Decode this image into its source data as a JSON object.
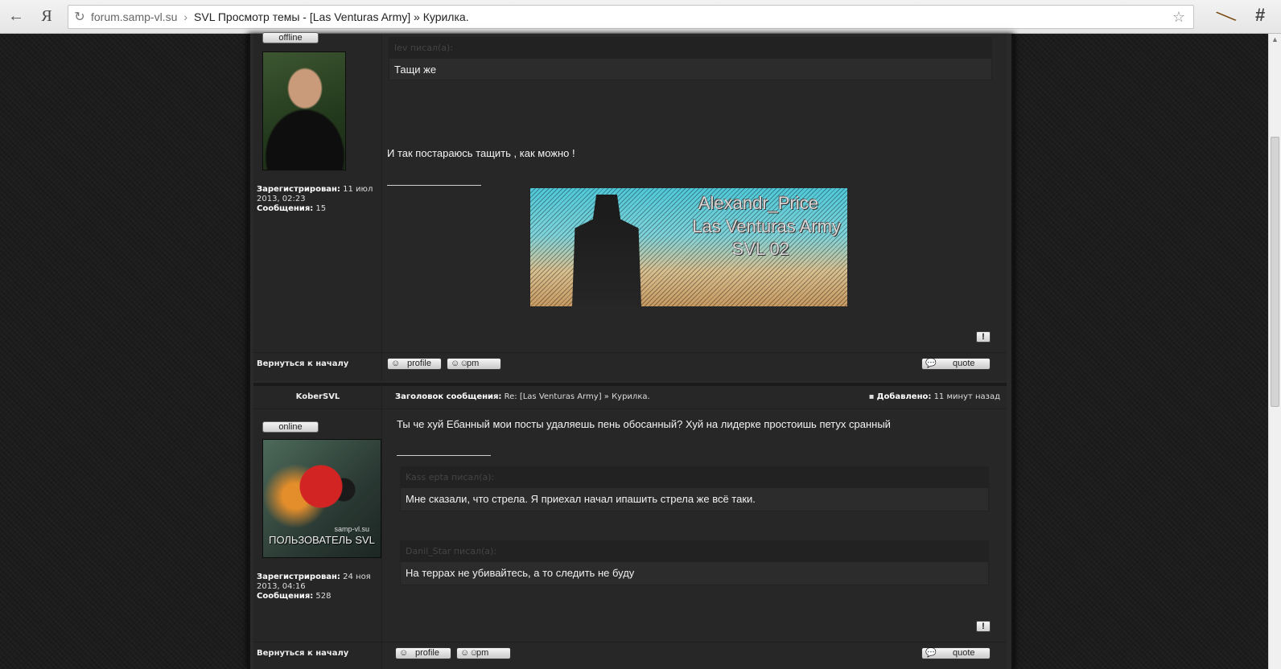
{
  "browser": {
    "back_icon": "←",
    "yandex_logo": "Я",
    "reload_icon": "↻",
    "url_domain": "forum.samp-vl.su",
    "url_separator": "›",
    "page_title": "SVL Просмотр темы - [Las Venturas Army] » Курилка.",
    "star_icon": "☆",
    "extension_icon_1": "╲",
    "extension_icon_2": "#"
  },
  "posts": [
    {
      "status": "offline",
      "registered_label": "Зарегистрирован:",
      "registered_value": "11 июл 2013, 02:23",
      "messages_label": "Сообщения:",
      "messages_value": "15",
      "quote_author": "lev писал(а):",
      "quote_text": "Тащи же",
      "text": "И так постараюсь тащить , как можно !",
      "banner": {
        "line1": "Alexandr_Price",
        "line2": "Las Venturas Army",
        "line3": "SVL 02"
      },
      "report_icon": "!",
      "back_to_top": "Вернуться к началу",
      "profile_label": "profile",
      "pm_label": "pm",
      "quote_label": "quote"
    },
    {
      "author": "KoberSVL",
      "subject_label": "Заголовок сообщения:",
      "subject_value": "Re: [Las Venturas Army] » Курилка.",
      "posted_label": "Добавлено:",
      "posted_value": "11 минут назад",
      "status": "online",
      "avatar_site": "samp-vl.su",
      "avatar_caption": "ПОЛЬЗОВАТЕЛЬ SVL",
      "registered_label": "Зарегистрирован:",
      "registered_value": "24 ноя 2013, 04:16",
      "messages_label": "Сообщения:",
      "messages_value": "528",
      "text": "Ты че хуй Ебанный мои посты удаляешь пень обосанный? Хуй на лидерке простоишь петух сранный",
      "quotes": [
        {
          "author": "Kass epta писал(а):",
          "text": "Мне сказали, что стрела. Я приехал начал ипашить стрела же всё таки."
        },
        {
          "author": "Danil_Star писал(а):",
          "text": "На террах не убивайтесь, а то следить не буду"
        }
      ],
      "report_icon": "!",
      "back_to_top": "Вернуться к началу",
      "profile_label": "profile",
      "pm_label": "pm",
      "quote_label": "quote"
    }
  ]
}
